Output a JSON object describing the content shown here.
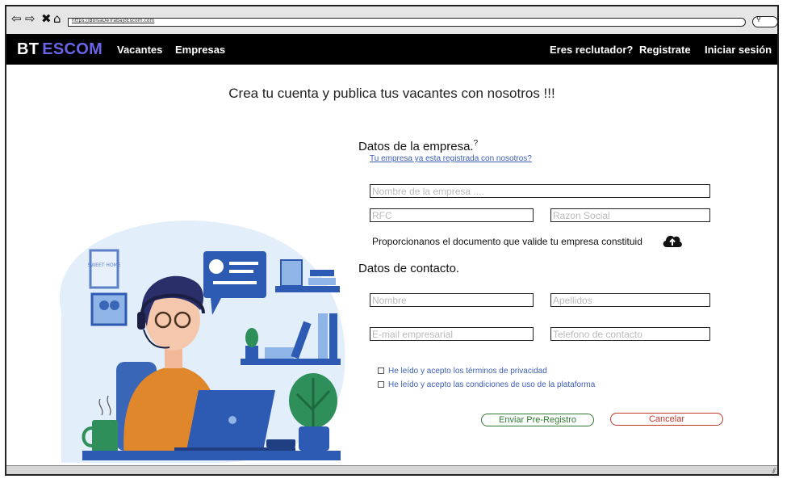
{
  "browser": {
    "url": "https://BolsaDeTrabajoEscom.com",
    "icons": [
      "back-icon",
      "forward-icon",
      "close-icon",
      "home-icon",
      "search-icon"
    ]
  },
  "header": {
    "brand_bt": "BT",
    "brand_escom": "ESCOM",
    "nav": {
      "vacantes": "Vacantes",
      "empresas": "Empresas"
    },
    "right": {
      "reclutador": "Eres reclutador?",
      "registrate": "Registrate",
      "login": "Iniciar sesión"
    }
  },
  "headline": "Crea tu cuenta y publica tus vacantes con nosotros !!!",
  "company": {
    "title": "Datos de la empresa.",
    "help_glyph": "?",
    "registered_link": "Tu empresa ya esta registrada con nosotros?",
    "name_placeholder": "Nombre de la empresa ....",
    "rfc_placeholder": "RFC",
    "razon_placeholder": "Razon Social",
    "upload_text": "Proporcionanos el documento que valide tu empresa constituid"
  },
  "contact": {
    "title": "Datos de contacto.",
    "nombre_placeholder": "Nombre",
    "apellidos_placeholder": "Apellidos",
    "email_placeholder": "E-mail empresarial",
    "telefono_placeholder": "Telefono de contacto"
  },
  "checks": {
    "privacy": "He leído y acepto los términos de privacidad",
    "terms": "He leído y acepto las condiciones de uso de la plataforma"
  },
  "buttons": {
    "send": "Enviar Pre-Registro",
    "cancel": "Cancelar"
  },
  "illustration": {
    "frame_text": "SWEET HOME"
  },
  "colors": {
    "brand_accent": "#6b63e8",
    "link": "#3b5fb5",
    "send": "#2f7a30",
    "cancel": "#c0392b"
  }
}
